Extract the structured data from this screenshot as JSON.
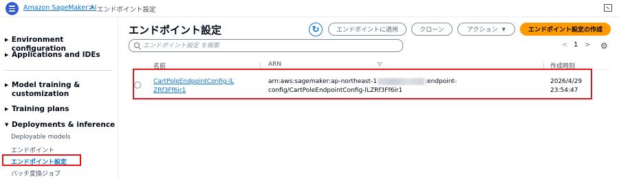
{
  "header": {
    "breadcrumb_root": "Amazon SageMaker AI",
    "breadcrumb_sep": ">",
    "breadcrumb_current": "エンドポイント設定"
  },
  "sidebar": {
    "sections": [
      {
        "label": "Environment configuration",
        "caret": "▶"
      },
      {
        "label": "Applications and IDEs",
        "caret": "▶"
      },
      {
        "label": "Model training & customization",
        "caret": "▶"
      },
      {
        "label": "Training plans",
        "caret": "▶"
      },
      {
        "label": "Deployments & inference",
        "caret": "▼"
      }
    ],
    "subitems": [
      {
        "label": "Deployable models"
      },
      {
        "label": "エンドポイント"
      },
      {
        "label": "エンドポイント設定"
      },
      {
        "label": "バッチ変換ジョブ"
      }
    ]
  },
  "main": {
    "title": "エンドポイント設定",
    "refresh_icon": "↻",
    "buttons": {
      "apply": "エンドポイントに適用",
      "clone": "クローン",
      "actions": "アクション",
      "actions_caret": "▼",
      "create": "エンドポイント設定の作成"
    },
    "search": {
      "placeholder": "エンドポイント設定 を検索"
    },
    "pagination": {
      "prev": "<",
      "page": "1",
      "next": ">"
    },
    "gear_icon": "⚙",
    "table": {
      "headers": {
        "name": "名前",
        "arn": "ARN",
        "created": "作成時刻"
      },
      "sort_icon": "▽",
      "rows": [
        {
          "name": "CartPoleEndpointConfig-lLZRf3Ff6ir1",
          "arn_prefix": "arn:aws:sagemaker:ap-northeast-1",
          "arn_suffix": ":endpoint-config/CartPoleEndpointConfig-lLZRf3Ff6ir1",
          "created_date": "2026/4/29",
          "created_time": "23:54:47"
        }
      ]
    }
  },
  "colors": {
    "accent": "#0972d3",
    "primary_button": "#ff9900",
    "highlight_box": "#e8131a",
    "menu_button": "#2f5cd6"
  }
}
